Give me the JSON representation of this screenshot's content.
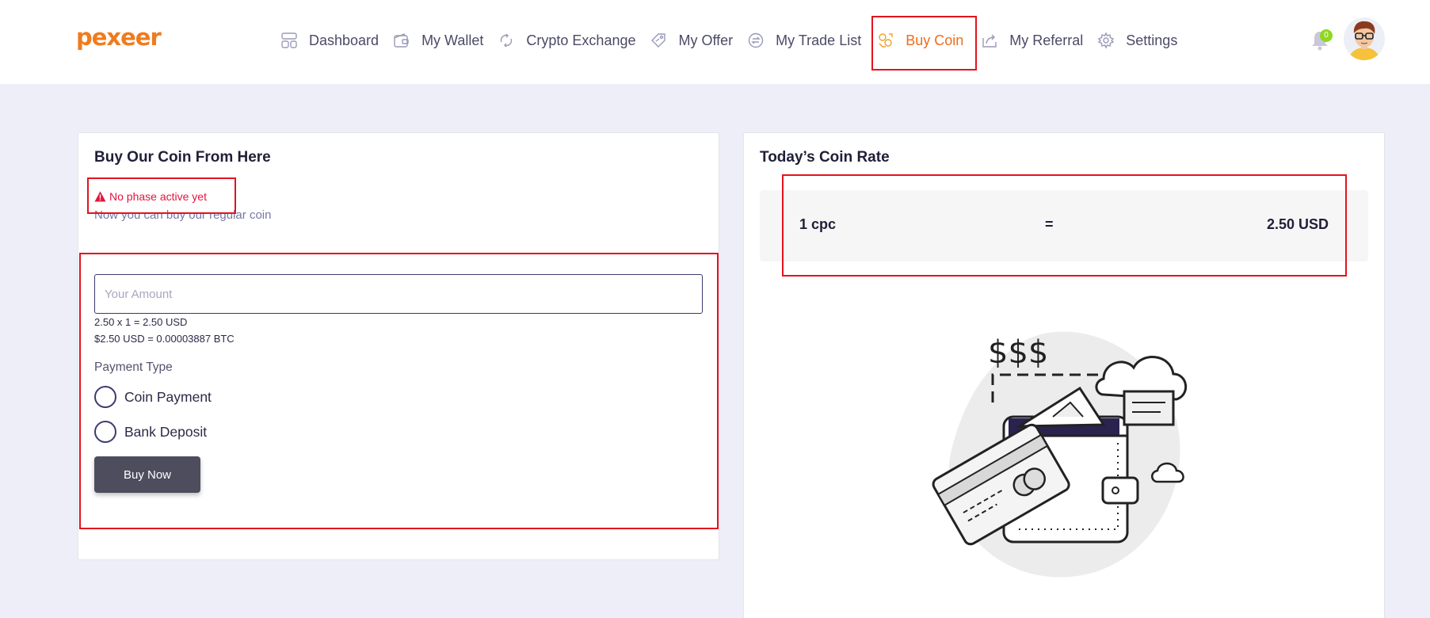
{
  "brand": {
    "logo_text": "pexeer",
    "color": "#f07b1c"
  },
  "nav": {
    "items": [
      {
        "label": "Dashboard",
        "icon": "dashboard-icon"
      },
      {
        "label": "My Wallet",
        "icon": "wallet-icon"
      },
      {
        "label": "Crypto Exchange",
        "icon": "exchange-icon"
      },
      {
        "label": "My Offer",
        "icon": "offer-tag-icon"
      },
      {
        "label": "My Trade List",
        "icon": "trade-cycle-icon"
      },
      {
        "label": "Buy Coin",
        "icon": "coins-icon",
        "active": true
      },
      {
        "label": "My Referral",
        "icon": "referral-share-icon"
      },
      {
        "label": "Settings",
        "icon": "gear-icon"
      }
    ]
  },
  "notifications": {
    "count": "0",
    "icon": "bell-icon"
  },
  "user": {
    "avatar": "avatar"
  },
  "buy_card": {
    "title": "Buy Our Coin From Here",
    "alert": "No phase active yet",
    "subtext": "Now you can buy our regular coin",
    "amount_placeholder": "Your Amount",
    "calc_line1": "2.50 x 1 = 2.50 USD",
    "calc_line2": "$2.50 USD = 0.00003887 BTC",
    "payment_type_label": "Payment Type",
    "payment_options": [
      "Coin Payment",
      "Bank Deposit"
    ],
    "buy_button": "Buy Now"
  },
  "rate_card": {
    "title": "Today’s Coin Rate",
    "left": "1 cpc",
    "equals": "=",
    "right": "2.50 USD",
    "illustration_text": "$$$"
  },
  "colors": {
    "accent": "#ef6d19",
    "alert": "#e3143d",
    "highlight": "#e5121e",
    "button": "#4e4d5e",
    "background": "#eeeef8"
  }
}
